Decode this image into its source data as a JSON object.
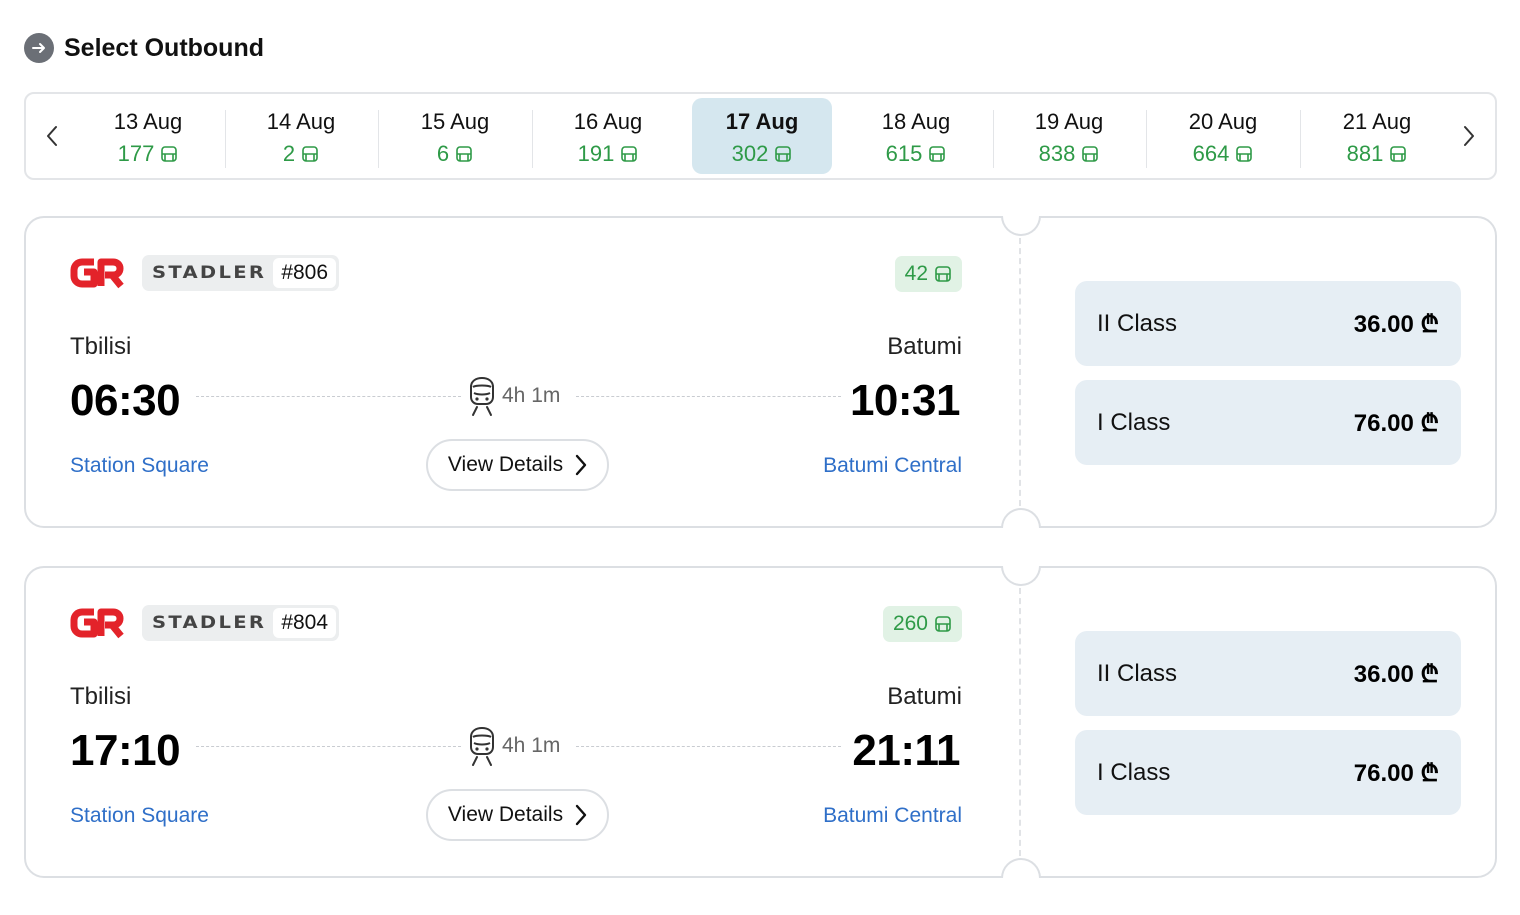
{
  "header": {
    "title": "Select Outbound"
  },
  "dates": [
    {
      "date": "13 Aug",
      "count": "177",
      "selected": false
    },
    {
      "date": "14 Aug",
      "count": "2",
      "selected": false
    },
    {
      "date": "15 Aug",
      "count": "6",
      "selected": false
    },
    {
      "date": "16 Aug",
      "count": "191",
      "selected": false
    },
    {
      "date": "17 Aug",
      "count": "302",
      "selected": true
    },
    {
      "date": "18 Aug",
      "count": "615",
      "selected": false
    },
    {
      "date": "19 Aug",
      "count": "838",
      "selected": false
    },
    {
      "date": "20 Aug",
      "count": "664",
      "selected": false
    },
    {
      "date": "21 Aug",
      "count": "881",
      "selected": false
    }
  ],
  "trips": [
    {
      "operator_logo": "GR",
      "manufacturer": "STADLER",
      "train_number": "#806",
      "seats": "42",
      "from_city": "Tbilisi",
      "to_city": "Batumi",
      "departure": "06:30",
      "arrival": "10:31",
      "duration": "4h 1m",
      "from_station": "Station Square",
      "to_station": "Batumi Central",
      "details_label": "View Details",
      "fares": [
        {
          "class": "II Class",
          "price": "36.00 ₾"
        },
        {
          "class": "I Class",
          "price": "76.00 ₾"
        }
      ]
    },
    {
      "operator_logo": "GR",
      "manufacturer": "STADLER",
      "train_number": "#804",
      "seats": "260",
      "from_city": "Tbilisi",
      "to_city": "Batumi",
      "departure": "17:10",
      "arrival": "21:11",
      "duration": "4h 1m",
      "from_station": "Station Square",
      "to_station": "Batumi Central",
      "details_label": "View Details",
      "fares": [
        {
          "class": "II Class",
          "price": "36.00 ₾"
        },
        {
          "class": "I Class",
          "price": "76.00 ₾"
        }
      ]
    }
  ],
  "colors": {
    "accent_green": "#2e9a47",
    "link_blue": "#2f6fc8",
    "selected_bg": "#d5e7ef",
    "brand_red": "#e3232a"
  },
  "icons": {
    "header": "arrow-right-circle-icon",
    "date_prev": "chevron-left-icon",
    "date_next": "chevron-right-icon",
    "seat": "seat-icon",
    "train": "train-icon",
    "details": "chevron-right-icon"
  }
}
